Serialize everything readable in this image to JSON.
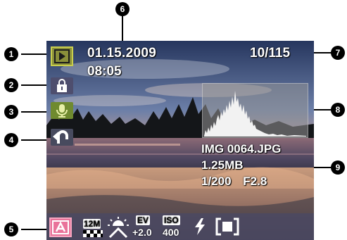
{
  "screen": {
    "date": "01.15.2009",
    "time": "08:05",
    "counter": "10/115",
    "filename": "IMG 0064.JPG",
    "filesize": "1.25MB",
    "exposure": "1/200  F2.8"
  },
  "bottom_bar": {
    "resolution": "12M",
    "ev_label": "EV",
    "ev_value": "+2.0",
    "iso_label": "ISO",
    "iso_value": "400"
  },
  "icons": {
    "play": "play-icon",
    "protect": "lock-icon",
    "voice_memo": "microphone-icon",
    "rotate": "rotate-icon",
    "scene": "auto-scene-icon",
    "white_balance": "sunny-icon",
    "flash": "flash-icon",
    "metering": "metering-icon"
  },
  "callouts": [
    "1",
    "2",
    "3",
    "4",
    "5",
    "6",
    "7",
    "8",
    "9"
  ],
  "colors": {
    "play_box": "#8a8f3a",
    "mic_box": "#6f8a2f",
    "scene_box": "#e9739a",
    "callout": "#000000"
  }
}
